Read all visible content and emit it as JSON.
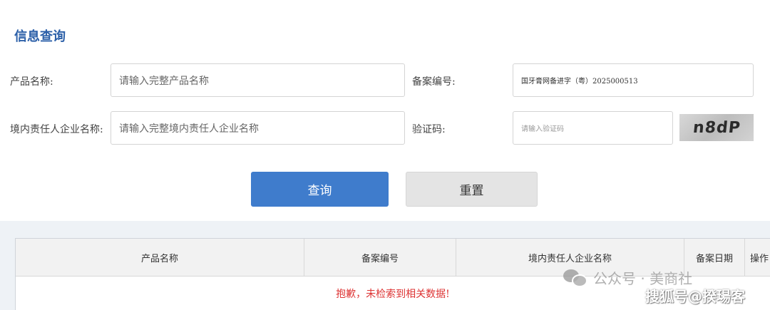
{
  "page_title": "信息查询",
  "form": {
    "product_name_label": "产品名称:",
    "product_name_placeholder": "请输入完整产品名称",
    "record_no_label": "备案编号:",
    "record_no_value": "国牙膏网备进字（粤）2025000513",
    "company_label": "境内责任人企业名称:",
    "company_placeholder": "请输入完整境内责任人企业名称",
    "captcha_label": "验证码:",
    "captcha_placeholder": "请输入验证码",
    "captcha_text": "n8dP"
  },
  "buttons": {
    "query": "查询",
    "reset": "重置"
  },
  "table": {
    "columns": [
      "产品名称",
      "备案编号",
      "境内责任人企业名称",
      "备案日期",
      "操作"
    ],
    "empty_message": "抱歉，未检索到相关数据!"
  },
  "watermark": {
    "wechat": "公众号 · 美商社",
    "sohu": "搜狐号@揆瑒客"
  }
}
